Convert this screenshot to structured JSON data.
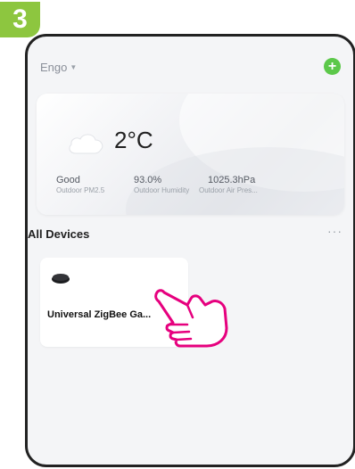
{
  "step": {
    "number": "3"
  },
  "header": {
    "home_name": "Engo",
    "caret_icon": "chevron-down-icon",
    "add_icon": "plus-icon",
    "add_label": "+"
  },
  "weather": {
    "icon": "cloud-icon",
    "temperature": "2°C",
    "stats": [
      {
        "value": "Good",
        "label": "Outdoor PM2.5"
      },
      {
        "value": "93.0%",
        "label": "Outdoor Humidity"
      },
      {
        "value": "1025.3hPa",
        "label": "Outdoor Air Pres..."
      }
    ]
  },
  "devices": {
    "section_title": "All Devices",
    "more_label": "···",
    "items": [
      {
        "name": "Universal ZigBee Ga...",
        "icon": "gateway-icon"
      }
    ]
  },
  "overlay": {
    "pointer_icon": "hand-pointer-icon",
    "color": "#e6007e"
  },
  "colors": {
    "accent": "#5cc84a",
    "step_badge": "#8dc63f"
  }
}
